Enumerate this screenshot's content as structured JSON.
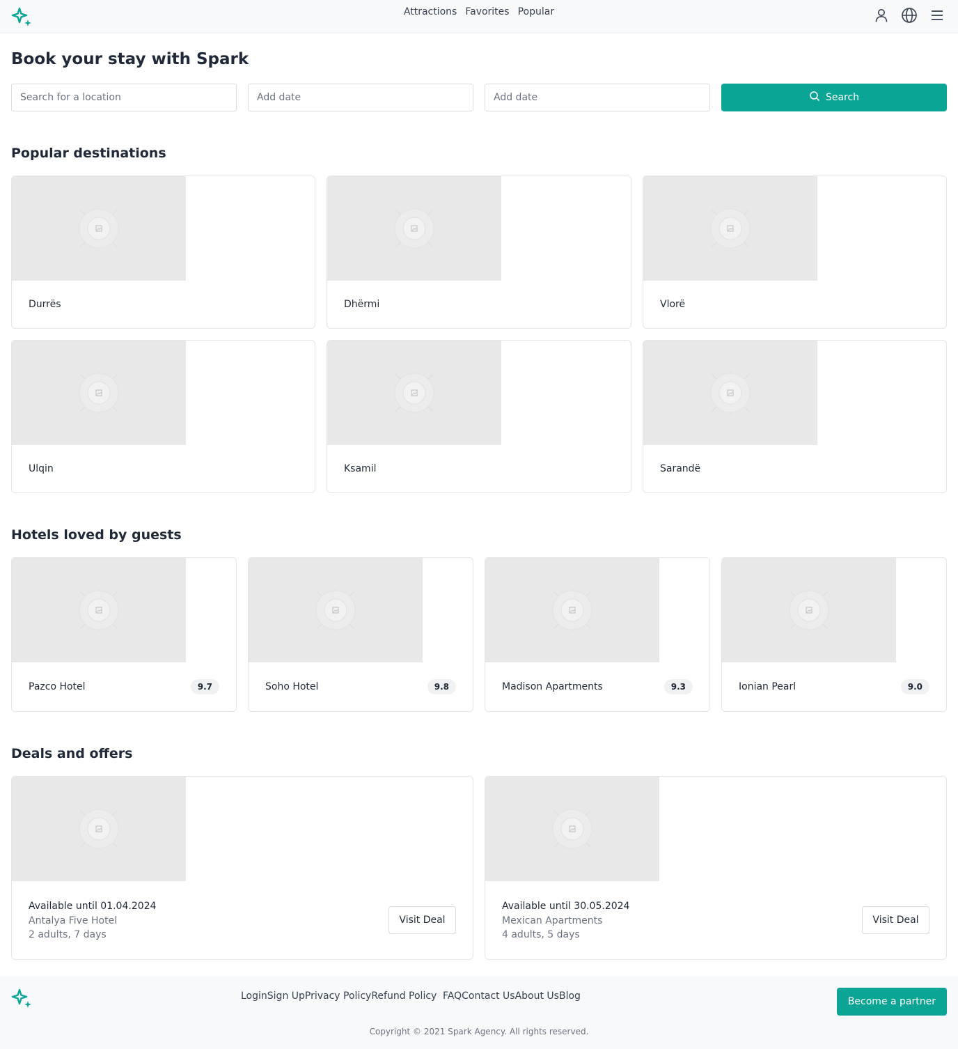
{
  "header": {
    "nav": [
      "Attractions",
      "Favorites",
      "Popular"
    ],
    "icons": [
      "user-icon",
      "globe-icon",
      "menu-icon"
    ],
    "brand_color": "#0aa595"
  },
  "hero": {
    "title": "Book your stay with Spark",
    "location_placeholder": "Search for a location",
    "checkin_placeholder": "Add date",
    "checkout_placeholder": "Add date",
    "search_label": "Search"
  },
  "destinations": {
    "title": "Popular destinations",
    "items": [
      "Durrës",
      "Dhërmi",
      "Vlorë",
      "Ulqin",
      "Ksamil",
      "Sarandë"
    ]
  },
  "hotels": {
    "title": "Hotels loved by guests",
    "items": [
      {
        "name": "Pazco Hotel",
        "rating": "9.7"
      },
      {
        "name": "Soho Hotel",
        "rating": "9.8"
      },
      {
        "name": "Madison Apartments",
        "rating": "9.3"
      },
      {
        "name": "Ionian Pearl",
        "rating": "9.0"
      }
    ]
  },
  "deals": {
    "title": "Deals and offers",
    "items": [
      {
        "until": "Available until 01.04.2024",
        "name": "Antalya Five Hotel",
        "guests": "2 adults, 7 days",
        "button": "Visit Deal"
      },
      {
        "until": "Available until 30.05.2024",
        "name": "Mexican Apartments",
        "guests": "4 adults, 5 days",
        "button": "Visit Deal"
      }
    ]
  },
  "footer": {
    "links_group_1": [
      "Login",
      "Sign Up",
      "Privacy Policy",
      "Refund Policy"
    ],
    "links_group_2": [
      "FAQ",
      "Contact Us",
      "About Us",
      "Blog"
    ],
    "partner_label": "Become a partner",
    "copyright": "Copyright © 2021 Spark Agency. All rights reserved."
  }
}
